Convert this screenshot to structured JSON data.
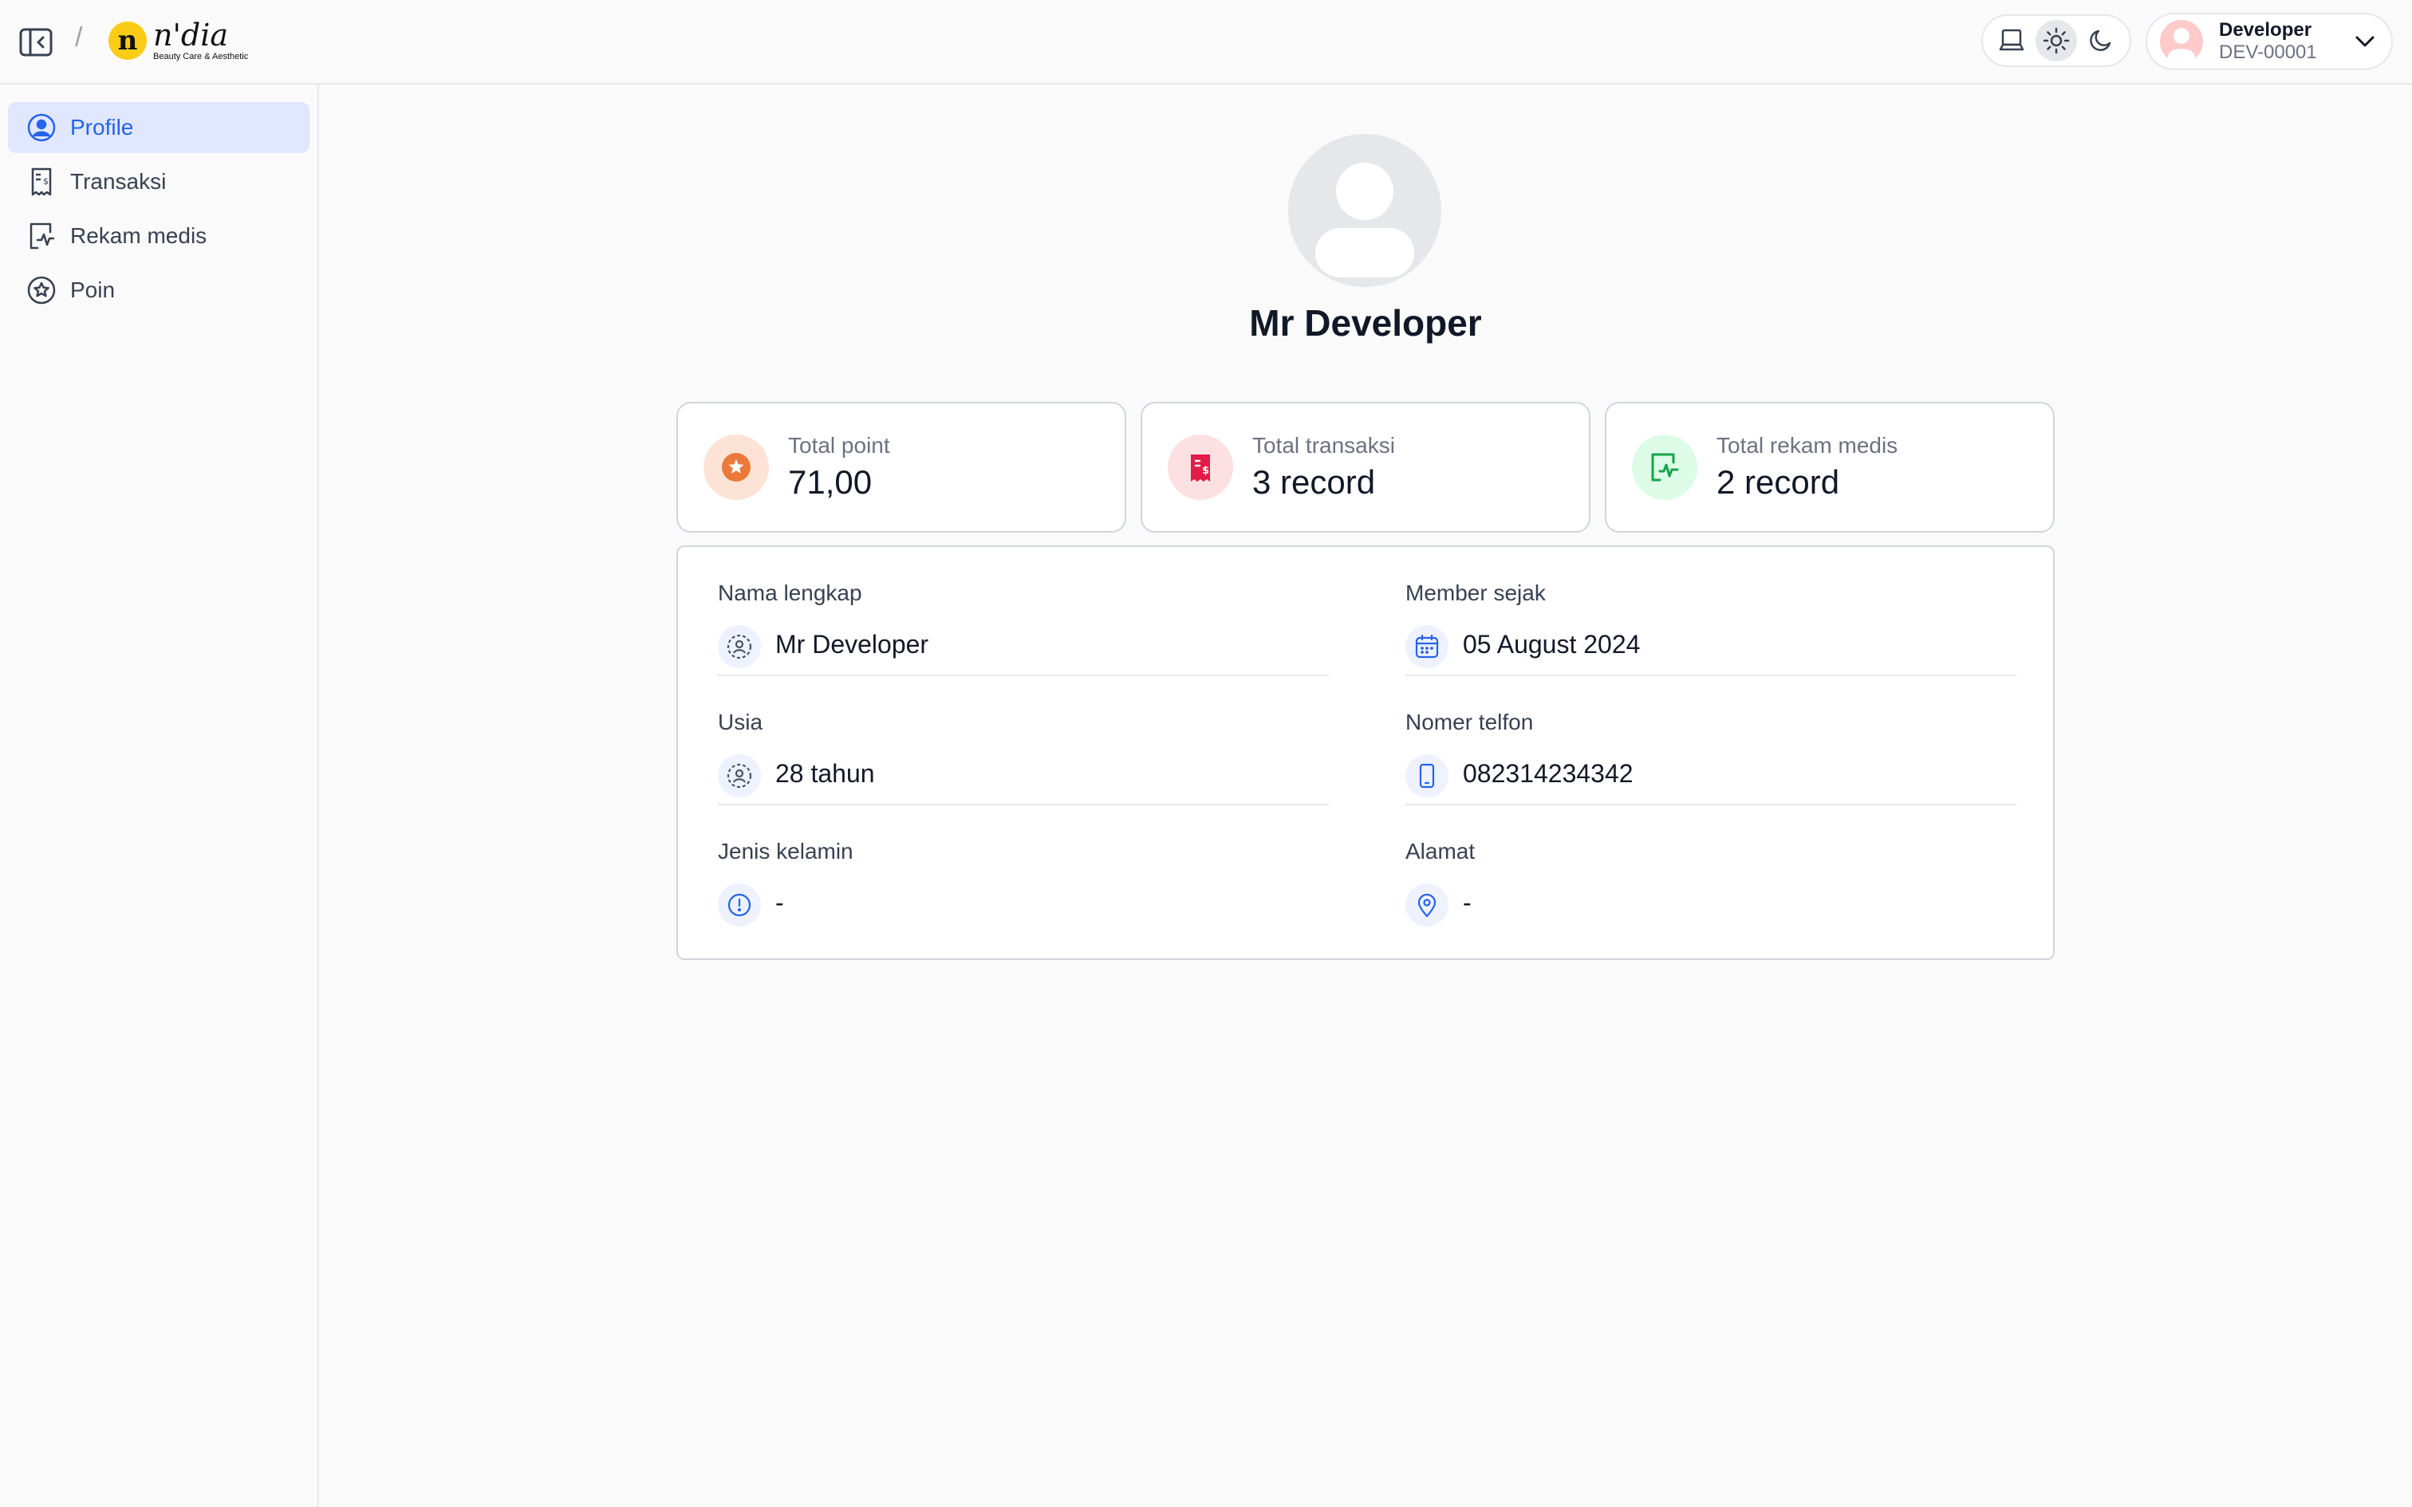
{
  "header": {
    "breadcrumb_separator": "/",
    "logo": {
      "mark": "n",
      "word": "n'dia",
      "tagline": "Beauty Care & Aesthetic"
    },
    "theme": {
      "options": [
        "system",
        "light",
        "dark"
      ],
      "selected": "light"
    },
    "user": {
      "name": "Developer",
      "id": "DEV-00001"
    }
  },
  "sidebar": {
    "items": [
      {
        "label": "Profile",
        "icon": "user-circle-icon",
        "active": true
      },
      {
        "label": "Transaksi",
        "icon": "receipt-icon",
        "active": false
      },
      {
        "label": "Rekam medis",
        "icon": "medical-record-icon",
        "active": false
      },
      {
        "label": "Poin",
        "icon": "star-badge-icon",
        "active": false
      }
    ]
  },
  "profile": {
    "name": "Mr Developer"
  },
  "stats": [
    {
      "label": "Total point",
      "value": "71,00",
      "icon": "star-icon",
      "color": "#ea7a3a",
      "bg": "#fde3d6"
    },
    {
      "label": "Total transaksi",
      "value": "3 record",
      "icon": "receipt-icon",
      "color": "#e11d48",
      "bg": "#fde0e2"
    },
    {
      "label": "Total rekam medis",
      "value": "2 record",
      "icon": "medical-record-icon",
      "color": "#16a34a",
      "bg": "#dcfce7"
    }
  ],
  "details": {
    "full_name": {
      "label": "Nama lengkap",
      "value": "Mr Developer"
    },
    "member_since": {
      "label": "Member sejak",
      "value": "05 August 2024"
    },
    "age": {
      "label": "Usia",
      "value": "28 tahun"
    },
    "phone": {
      "label": "Nomer telfon",
      "value": "082314234342"
    },
    "gender": {
      "label": "Jenis kelamin",
      "value": "-"
    },
    "address": {
      "label": "Alamat",
      "value": "-"
    }
  },
  "colors": {
    "accent": "#2563eb",
    "accent_bg": "#e0e7ff",
    "border": "#d1d5db"
  }
}
